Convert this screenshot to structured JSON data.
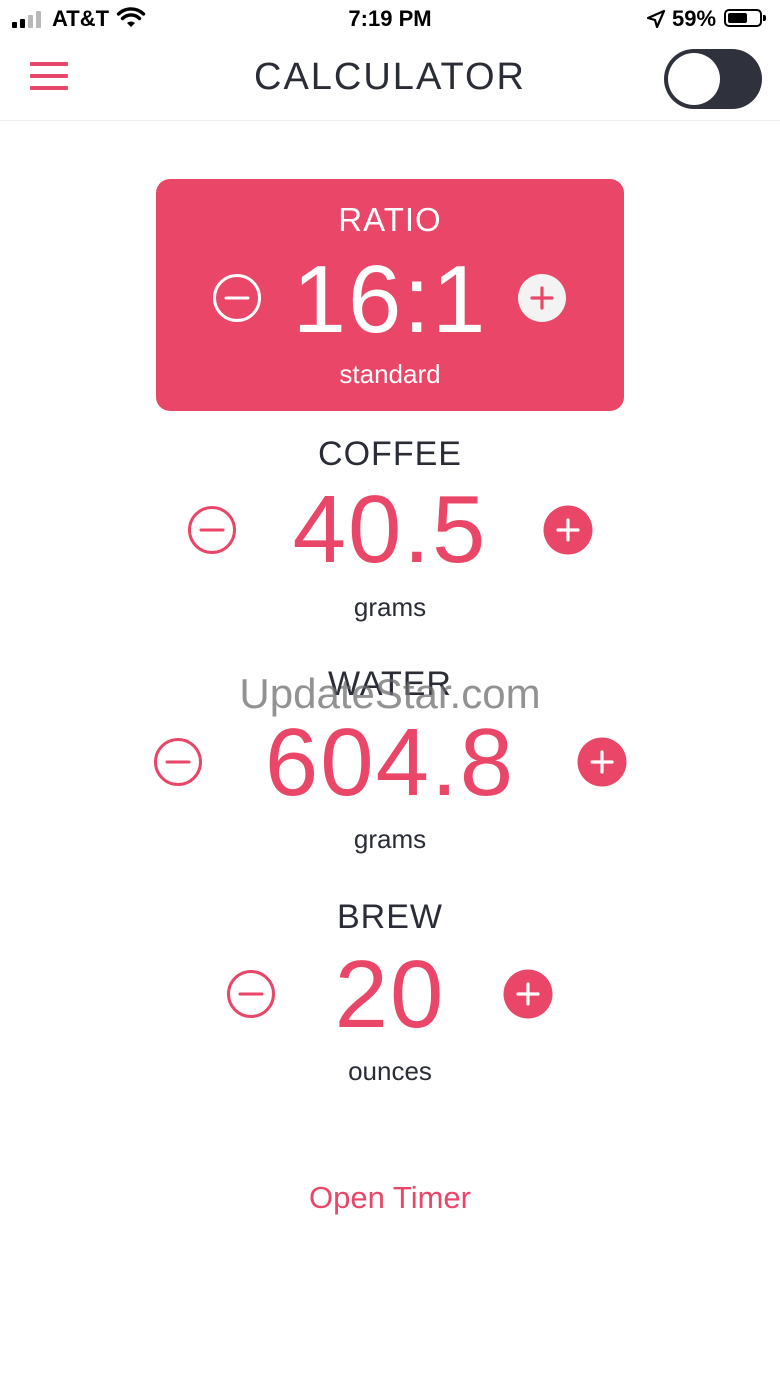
{
  "status_bar": {
    "carrier": "AT&T",
    "time": "7:19 PM",
    "battery": "59%"
  },
  "header": {
    "title": "CALCULATOR",
    "dark_mode_on": false
  },
  "ratio": {
    "label": "RATIO",
    "value": "16:1",
    "preset": "standard"
  },
  "coffee": {
    "label": "COFFEE",
    "value": "40.5",
    "unit": "grams"
  },
  "water": {
    "label": "WATER",
    "value": "604.8",
    "unit": "grams"
  },
  "brew": {
    "label": "BREW",
    "value": "20",
    "unit": "ounces"
  },
  "watermark": "UpdateStar.com",
  "actions": {
    "open_timer": "Open Timer"
  },
  "colors": {
    "accent": "#ea4667",
    "text": "#2a2d36",
    "toggle": "#2f323c"
  }
}
